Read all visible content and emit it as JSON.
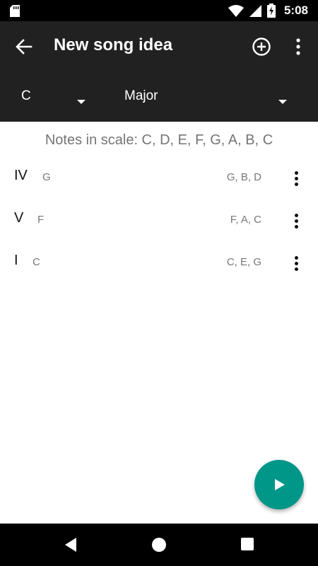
{
  "status_bar": {
    "time": "5:08"
  },
  "app_bar": {
    "title": "New song idea"
  },
  "selectors": {
    "key": "C",
    "mode": "Major"
  },
  "scale_notes": "Notes in scale: C, D, E, F, G, A, B, C",
  "progression": [
    {
      "numeral": "IV",
      "chord": "G",
      "notes": "G, B, D"
    },
    {
      "numeral": "V",
      "chord": "F",
      "notes": "F, A, C"
    },
    {
      "numeral": "I",
      "chord": "C",
      "notes": "C, E, G"
    }
  ],
  "colors": {
    "app_bar": "#212121",
    "fab": "#009688",
    "text_secondary": "#757575"
  },
  "icons": {
    "back": "arrow-back-icon",
    "add": "add-circle-icon",
    "more": "more-vert-icon",
    "fab": "play-icon",
    "nav_back": "nav-back-icon",
    "nav_home": "nav-home-icon",
    "nav_recents": "nav-recents-icon"
  }
}
